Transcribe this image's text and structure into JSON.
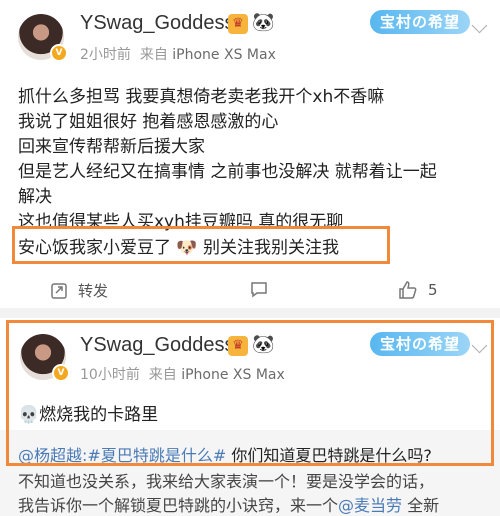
{
  "post1": {
    "username": "YSwag_Goddess",
    "time": "2小时前",
    "source_prefix": "来自",
    "device": "iPhone XS Max",
    "tag": "宝村の希望",
    "lines": [
      "抓什么多担骂 我要真想倚老卖老我开个xh不香嘛",
      "我说了姐姐很好 抱着感恩感激的心",
      "回来宣传帮帮新后援大家",
      "但是艺人经纪又在搞事情 之前事也没解决 就帮着让一起",
      "解决",
      "这也值得某些人买xyh挂豆瓣吗 真的很无聊",
      "安心饭我家小爱豆了 🐶 别关注我别关注我"
    ],
    "repost_label": "转发",
    "like_count": "5"
  },
  "post2": {
    "username": "YSwag_Goddess",
    "time": "10小时前",
    "source_prefix": "来自",
    "device": "iPhone XS Max",
    "tag": "宝村の希望",
    "text": "燃烧我的卡路里",
    "emoji": "💀",
    "repost_user": "@杨超越",
    "repost_topic": ":#夏巴特跳是什么#",
    "repost_question": " 你们知道夏巴特跳是什么吗?",
    "body_line1": "不知道也没关系，我来给大家表演一个！要是没学会的话，",
    "body_line2_a": "我告诉你一个解锁夏巴特跳的小诀窍，来一个",
    "body_line2_link": "@麦当劳",
    "body_line2_b": " 全新"
  },
  "colors": {
    "accent_orange": "#f08a3a",
    "link_blue": "#4b7bb7",
    "tag_blue": "#58b7f0"
  }
}
